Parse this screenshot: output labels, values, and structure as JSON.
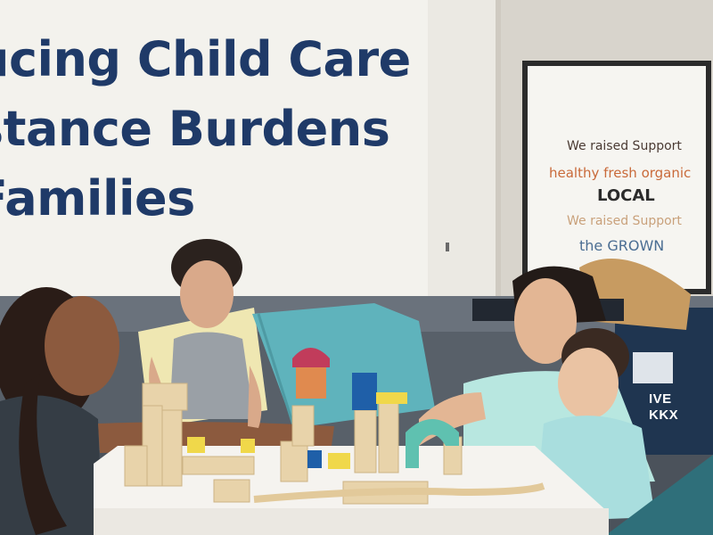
{
  "headline": {
    "line1": "ucing Child Care",
    "line2": "stance Burdens",
    "line3": "Families"
  },
  "poster": {
    "line1": "We raised Support",
    "line2": "healthy fresh organic",
    "line3": "LOCAL",
    "line4": "We raised Support",
    "line5": "the GROWN"
  },
  "bag_print": {
    "line1": "IVE",
    "line2": "KKX"
  },
  "colors": {
    "headline": "#1f3a68",
    "wall": "#d9d6cf",
    "window": "#f2f1ec",
    "sofa": "#58606b",
    "table": "#f4f2ee",
    "blocks": "#e8d3aa"
  }
}
